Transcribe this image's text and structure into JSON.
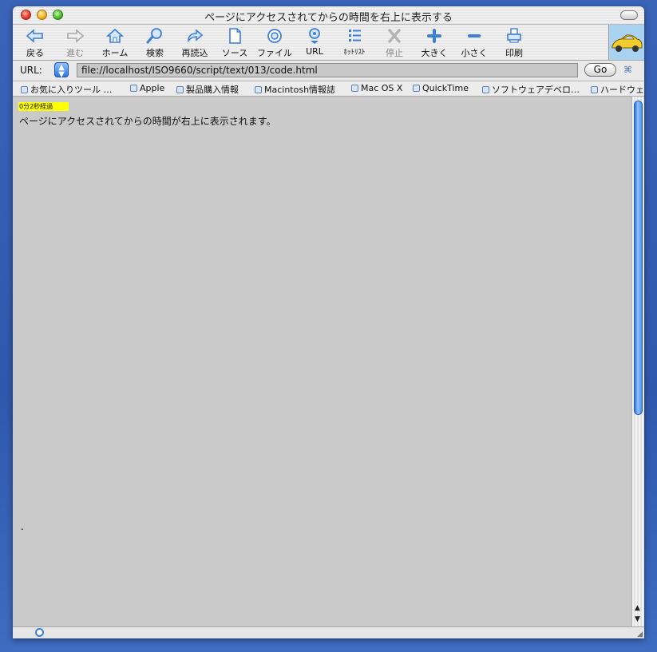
{
  "window": {
    "title": "ページにアクセスされてからの時間を右上に表示する"
  },
  "toolbar": {
    "buttons": [
      {
        "label": "戻る"
      },
      {
        "label": "進む"
      },
      {
        "label": "ホーム"
      },
      {
        "label": "検索"
      },
      {
        "label": "再読込"
      },
      {
        "label": "ソース"
      },
      {
        "label": "ファイル"
      },
      {
        "label": "URL"
      },
      {
        "label": "ﾎｯﾄﾘｽﾄ"
      },
      {
        "label": "停止"
      },
      {
        "label": "大きく"
      },
      {
        "label": "小さく"
      },
      {
        "label": "印刷"
      }
    ]
  },
  "urlbar": {
    "label": "URL:",
    "value": "file://localhost/ISO9660/script/text/013/code.html",
    "go_label": "Go"
  },
  "bookmarks": [
    {
      "label": "お気に入りツール …"
    },
    {
      "label": "Apple"
    },
    {
      "label": "製品購入情報"
    },
    {
      "label": "Macintosh情報誌"
    },
    {
      "label": "Mac OS X"
    },
    {
      "label": "QuickTime"
    },
    {
      "label": "ソフトウェアデベロ…"
    },
    {
      "label": "ハードウェ"
    }
  ],
  "content": {
    "timer_text": "0分2秒経過",
    "body_text": "ページにアクセスされてからの時間が右上に表示されます。",
    "stray_dot": "."
  },
  "colors": {
    "timer_bg": "#ffff00",
    "content_bg": "#cacaca",
    "accent": "#2f76e0"
  }
}
